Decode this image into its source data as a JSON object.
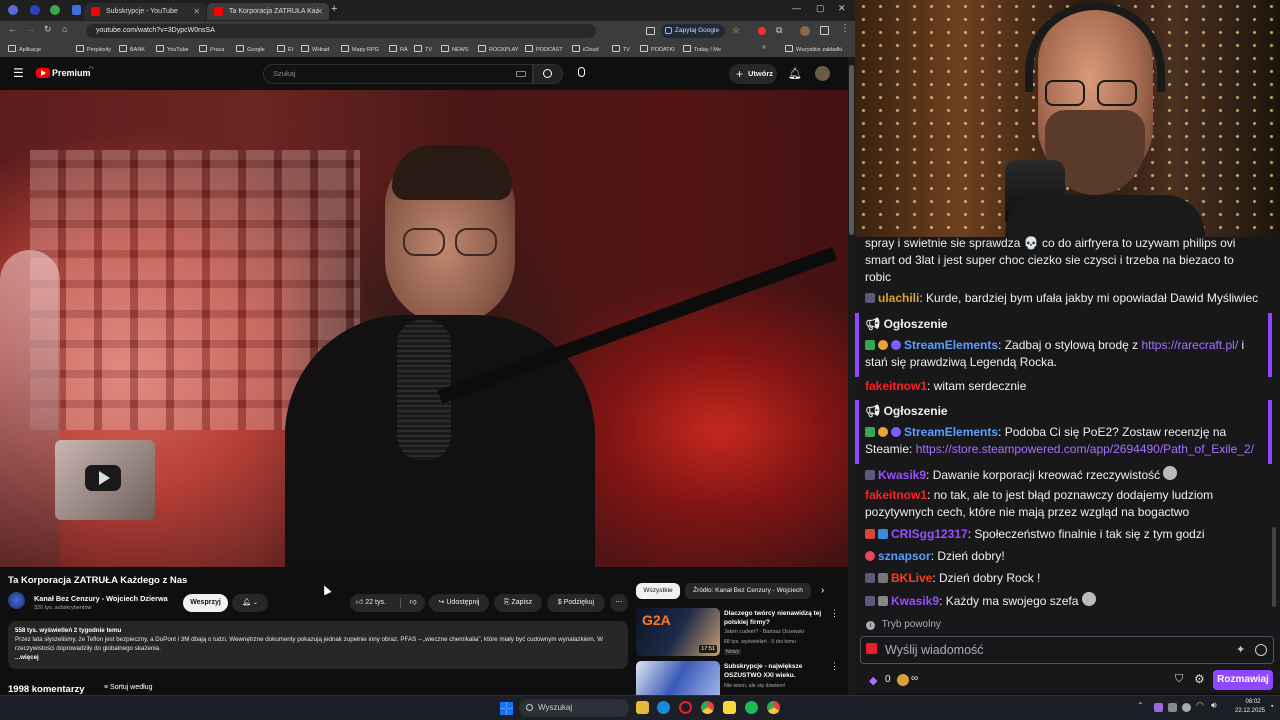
{
  "browser": {
    "tabs": [
      {
        "title": "Subskrypcje - YouTube"
      },
      {
        "title": "Ta Korporacja ZATRUŁA Każ"
      }
    ],
    "url": "youtube.com/watch?v=3DypcW0nsSA",
    "ask_google": "Zapytaj Google",
    "bookmarks": [
      "Aplikacje",
      "Perplexity",
      "BANK",
      "YouTube",
      "Praca",
      "Google",
      "EI",
      "WHrad",
      "Mapy RPG",
      "RA",
      "TV",
      "NEWS",
      "ROCKPLAY",
      "PODCAST",
      "iCloud",
      "TV",
      "PODATKI",
      "Today / Me"
    ],
    "all_bookmarks": "Wszystkie zakładki"
  },
  "youtube": {
    "logo": "Premium",
    "logo_sup": "PL",
    "search_placeholder": "Szukaj",
    "create_label": "Utwórz",
    "video_title": "Ta Korporacja ZATRUŁA Każdego z Nas",
    "channel_name": "Kanał Bez Cenzury - Wojciech Dzierwa",
    "subscribers": "320 tys. subskrybentów",
    "support_label": "Wesprzyj",
    "likes": "22 tys.",
    "share_label": "Udostępnij",
    "save_label": "Zapisz",
    "thanks_label": "Podziękuj",
    "views_line": "558 tys. wyświetleń  2 tygodnie temu",
    "description": "Przez lata słyszeliśmy, że Teflon jest bezpieczny, a DuPont i 3M dbają o ludzi. Wewnętrzne dokumenty pokazują jednak zupełnie inny obraz. PFAS – „wieczne chemikalia”, które miały być cudownym wynalazkiem. W rzeczywistości doprowadziły do globalnego skażenia.",
    "more": "...więcej",
    "comments_count": "1998 komentarzy",
    "sort_label": "Sortuj według",
    "chips": [
      "Wszystkie",
      "Źródło: Kanał Bez Cenzury - Wojciech"
    ],
    "recommendations": [
      {
        "title": "Dlaczego twórcy nienawidzą tej polskiej firmy?",
        "channel": "Jakim cudem? - Bartosz Orzewski",
        "meta": "68 tys. wyświetleń · 5 dni temu",
        "badge": "Nowy",
        "duration": "17:51",
        "thumb_text": "G2A"
      },
      {
        "title": "Subskrypcje - największe OSZUSTWO XXI wieku.",
        "channel": "Nie wiem, ale się dowiem!",
        "meta": "",
        "badge": "",
        "duration": "",
        "thumb_text": ""
      }
    ]
  },
  "chat": {
    "messages": [
      {
        "user": "",
        "user_color": "#efeff1",
        "text": "spray i swietnie sie sprawdza 💀 co do airfryera to uzywam philips ovi smart od 3lat i jest super choc ciezko sie czysci i trzeba na biezaco to robic"
      },
      {
        "user": "ulachili",
        "user_color": "#daa520",
        "text": "Kurde, bardziej bym ufała jakby mi opowiadał Dawid Myśliwiec"
      },
      {
        "announcement": "Ogłoszenie",
        "user": "StreamElements",
        "user_color": "#5c9eff",
        "text": "Zadbaj o stylową brodę z ",
        "link": "https://rarecraft.pl/",
        "text_after": " i stań się prawdziwą Legendą Rocka."
      },
      {
        "user": "fakeitnow1",
        "user_color": "#ff1f1f",
        "text": "witam serdecznie"
      },
      {
        "announcement": "Ogłoszenie",
        "user": "StreamElements",
        "user_color": "#5c9eff",
        "text": "Podoba Ci się PoE2? Zostaw recenzję na Steamie: ",
        "link": "https://store.steampowered.com/app/2694490/Path_of_Exile_2/",
        "text_after": ""
      },
      {
        "user": "Kwasik9",
        "user_color": "#9b4dff",
        "text": "Dawanie korporacji kreować rzeczywistość"
      },
      {
        "user": "fakeitnow1",
        "user_color": "#ff1f1f",
        "text": "no tak, ale to jest błąd poznawczy dodajemy ludziom pozytywnych cech, które nie mają przez wzgląd na bogactwo"
      },
      {
        "user": "CRISgg12317",
        "user_color": "#9b4dff",
        "text": "Społeczeństwo finalnie i tak się z tym godzi"
      },
      {
        "user": "sznapsor",
        "user_color": "#5c9eff",
        "text": "Dzień dobry!"
      },
      {
        "user": "BKLive",
        "user_color": "#ff3a1f",
        "text": "Dzień dobry Rock !"
      },
      {
        "user": "Kwasik9",
        "user_color": "#9b4dff",
        "text": "Każdy ma swojego szefa"
      }
    ],
    "slow_mode": "Tryb powolny",
    "input_placeholder": "Wyślij wiadomość",
    "points": "0",
    "chat_button": "Rozmawiaj"
  },
  "taskbar": {
    "search": "Wyszukaj",
    "time": "08:02",
    "date": "22.12.2025"
  },
  "colors": {
    "youtube_red": "#ff0000",
    "twitch_purple": "#9147ff"
  }
}
